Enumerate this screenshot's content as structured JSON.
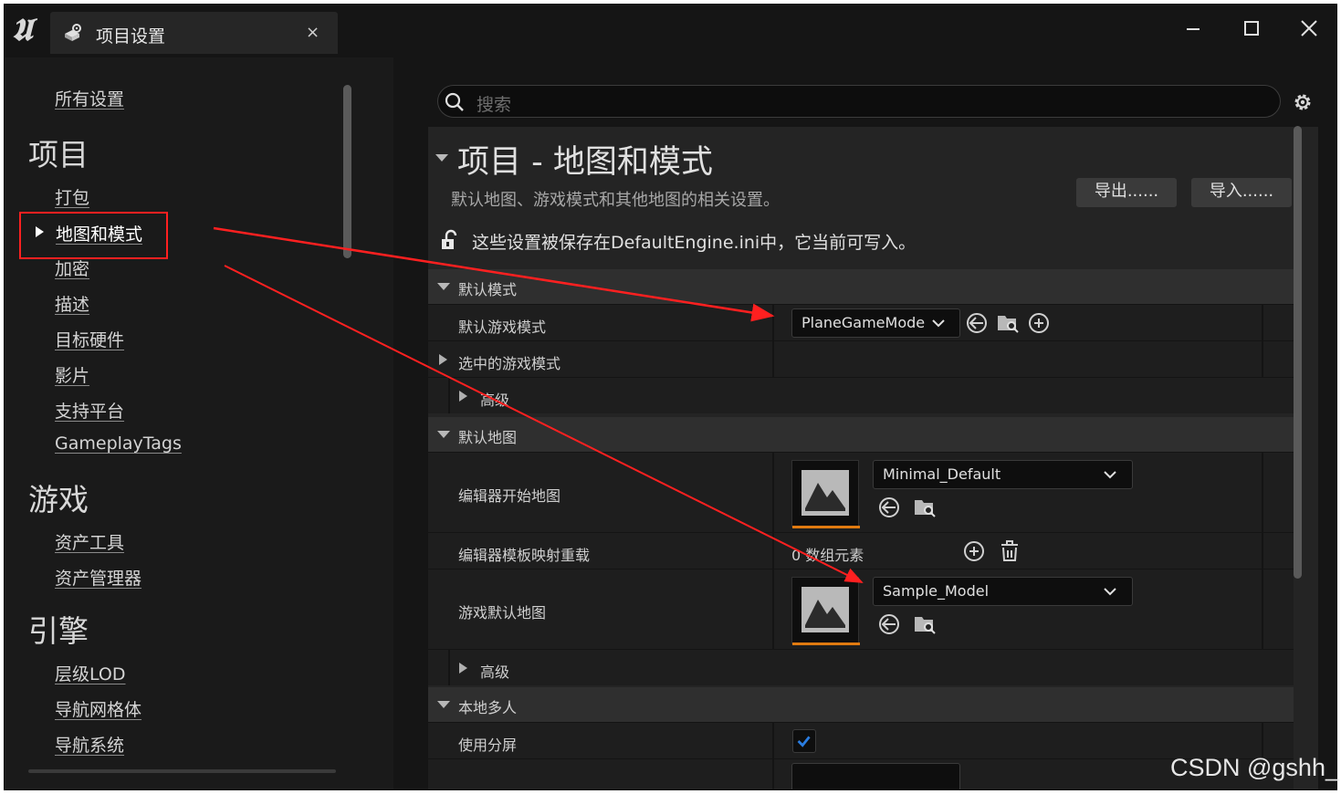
{
  "window": {
    "tab_title": "项目设置",
    "tab_close": "×"
  },
  "sidebar": {
    "all_settings": "所有设置",
    "sections": [
      {
        "title": "项目",
        "items": [
          "打包",
          "地图和模式",
          "加密",
          "描述",
          "目标硬件",
          "影片",
          "支持平台",
          "GameplayTags"
        ]
      },
      {
        "title": "游戏",
        "items": [
          "资产工具",
          "资产管理器"
        ]
      },
      {
        "title": "引擎",
        "items": [
          "层级LOD",
          "导航网格体",
          "导航系统"
        ]
      }
    ],
    "selected_item": "地图和模式"
  },
  "search": {
    "placeholder": "搜索"
  },
  "category": {
    "title": "项目 - 地图和模式",
    "description": "默认地图、游戏模式和其他地图的相关设置。",
    "export_label": "导出......",
    "import_label": "导入......",
    "save_note": "这些设置被保存在DefaultEngine.ini中，它当前可写入。"
  },
  "default_modes": {
    "header": "默认模式",
    "default_game_mode_label": "默认游戏模式",
    "default_game_mode_value": "PlaneGameMode",
    "selected_game_mode_label": "选中的游戏模式",
    "advanced_label": "高级"
  },
  "default_maps": {
    "header": "默认地图",
    "editor_startup_map_label": "编辑器开始地图",
    "editor_startup_map_value": "Minimal_Default",
    "editor_template_override_label": "编辑器模板映射重载",
    "array_elements": "0 数组元素",
    "game_default_map_label": "游戏默认地图",
    "game_default_map_value": "Sample_Model",
    "advanced_label": "高级"
  },
  "local_multiplayer": {
    "header": "本地多人",
    "use_splitscreen_label": "使用分屏",
    "use_splitscreen_checked": true
  },
  "annotation": {
    "color": "#ff2020"
  },
  "watermark": "CSDN @gshh_"
}
